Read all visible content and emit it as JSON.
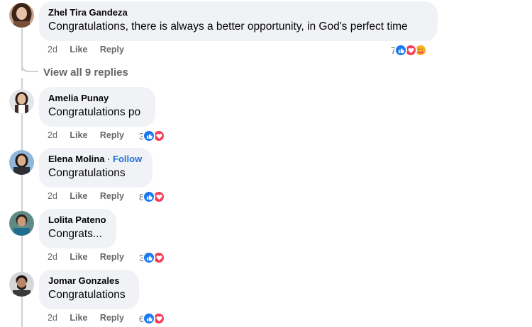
{
  "thread": {
    "view_replies_label": "View all 9 replies"
  },
  "comments": [
    {
      "author": "Zhel Tira Gandeza",
      "text": "Congratulations, there is always a better opportunity, in God's perfect time",
      "time": "2d",
      "like_label": "Like",
      "reply_label": "Reply",
      "reaction_count": "7",
      "reactions": [
        "like-icon",
        "love-icon",
        "care-icon"
      ]
    },
    {
      "author": "Amelia Punay",
      "text": "Congratulations po",
      "time": "2d",
      "like_label": "Like",
      "reply_label": "Reply",
      "reaction_count": "3",
      "reactions": [
        "like-icon",
        "love-icon"
      ]
    },
    {
      "author": "Elena Molina",
      "follow_label": "Follow",
      "text": "Congratulations",
      "time": "2d",
      "like_label": "Like",
      "reply_label": "Reply",
      "reaction_count": "8",
      "reactions": [
        "like-icon",
        "love-icon"
      ]
    },
    {
      "author": "Lolita Pateno",
      "text": "Congrats...",
      "time": "2d",
      "like_label": "Like",
      "reply_label": "Reply",
      "reaction_count": "3",
      "reactions": [
        "like-icon",
        "love-icon"
      ]
    },
    {
      "author": "Jomar Gonzales",
      "text": "Congratulations",
      "time": "2d",
      "like_label": "Like",
      "reply_label": "Reply",
      "reaction_count": "6",
      "reactions": [
        "like-icon",
        "love-icon"
      ]
    }
  ],
  "colors": {
    "bubble": "#f0f2f5",
    "like": "#1877f2",
    "love": "#f33e58",
    "follow": "#216fdb",
    "meta": "#65676b"
  }
}
